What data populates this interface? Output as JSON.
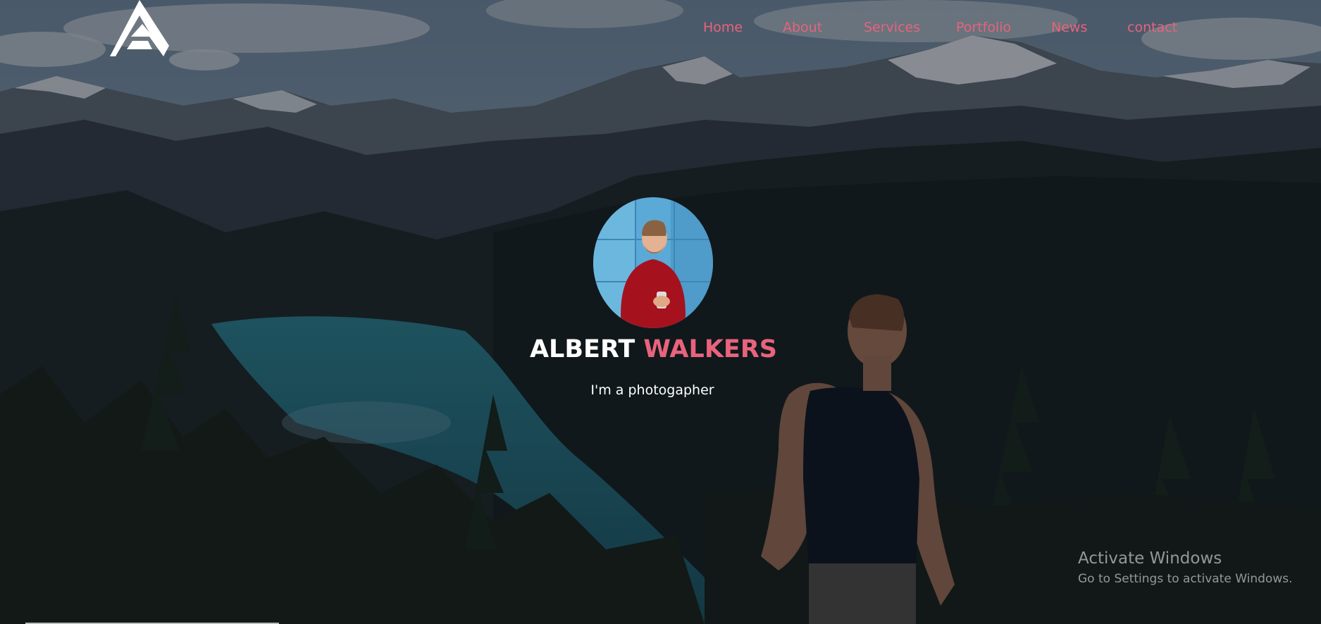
{
  "nav": {
    "items": [
      {
        "label": "Home"
      },
      {
        "label": "About"
      },
      {
        "label": "Services"
      },
      {
        "label": "Portfolio"
      },
      {
        "label": "News"
      },
      {
        "label": "contact"
      }
    ]
  },
  "hero": {
    "first_name": "ALBERT",
    "last_name": "WALKERS",
    "tagline": "I'm a photogapher"
  },
  "watermark": {
    "title": "Activate Windows",
    "subtitle": "Go to Settings to activate Windows."
  },
  "colors": {
    "accent": "#e8637c",
    "text": "#ffffff",
    "overlay": "#080e16"
  },
  "icons": {
    "logo": "letter-a-logo"
  }
}
